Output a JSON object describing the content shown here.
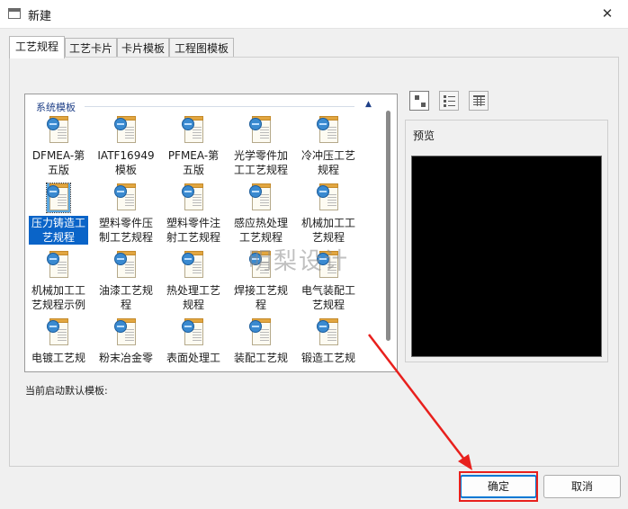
{
  "window": {
    "title": "新建",
    "close_glyph": "✕"
  },
  "tabs": [
    {
      "label": "工艺规程",
      "active": true
    },
    {
      "label": "工艺卡片",
      "active": false
    },
    {
      "label": "卡片模板",
      "active": false
    },
    {
      "label": "工程图模板",
      "active": false
    }
  ],
  "templates": {
    "group_label": "系统模板",
    "collapse_icon": "chevron-up-icon",
    "items": [
      {
        "label": "DFMEA-第五版",
        "icon": "document-globe-icon"
      },
      {
        "label": "IATF16949模板",
        "icon": "document-globe-icon"
      },
      {
        "label": "PFMEA-第五版",
        "icon": "document-globe-icon"
      },
      {
        "label": "光学零件加工工艺规程",
        "icon": "document-globe-icon"
      },
      {
        "label": "冷冲压工艺规程",
        "icon": "document-globe-icon"
      },
      {
        "label": "压力铸造工艺规程",
        "icon": "document-globe-icon",
        "selected": true
      },
      {
        "label": "塑料零件压制工艺规程",
        "icon": "document-globe-icon"
      },
      {
        "label": "塑料零件注射工艺规程",
        "icon": "document-globe-icon"
      },
      {
        "label": "感应热处理工艺规程",
        "icon": "document-globe-icon"
      },
      {
        "label": "机械加工工艺规程",
        "icon": "document-globe-icon"
      },
      {
        "label": "机械加工工艺规程示例",
        "icon": "document-globe-icon"
      },
      {
        "label": "油漆工艺规程",
        "icon": "document-globe-icon"
      },
      {
        "label": "热处理工艺规程",
        "icon": "document-globe-icon"
      },
      {
        "label": "焊接工艺规程",
        "icon": "document-globe-icon"
      },
      {
        "label": "电气装配工艺规程",
        "icon": "document-globe-icon"
      },
      {
        "label": "电镀工艺规",
        "icon": "document-globe-icon"
      },
      {
        "label": "粉末冶金零",
        "icon": "document-globe-icon"
      },
      {
        "label": "表面处理工",
        "icon": "document-globe-icon"
      },
      {
        "label": "装配工艺规",
        "icon": "document-globe-icon"
      },
      {
        "label": "锻造工艺规",
        "icon": "document-globe-icon"
      }
    ]
  },
  "default_template_label": "当前启动默认模板:",
  "view_modes": [
    {
      "icon": "large-icons-view-icon",
      "active": true
    },
    {
      "icon": "small-icons-view-icon",
      "active": false
    },
    {
      "icon": "details-view-icon",
      "active": false
    }
  ],
  "preview": {
    "label": "预览"
  },
  "watermark": "明梨设计",
  "buttons": {
    "ok": "确定",
    "cancel": "取消"
  },
  "annotation": {
    "color": "#e8201d"
  }
}
